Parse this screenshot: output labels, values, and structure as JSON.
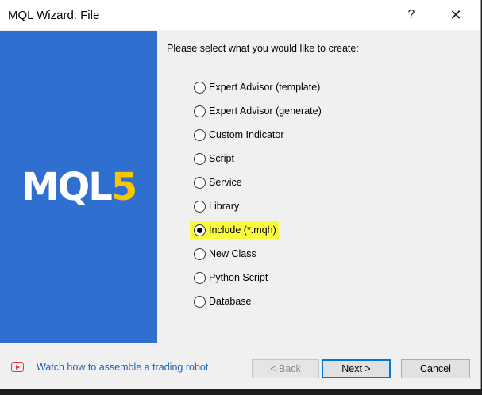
{
  "window": {
    "title": "MQL Wizard: File",
    "help_label": "?",
    "close_label": "✕"
  },
  "banner": {
    "logo_main": "MQL",
    "logo_accent": "5",
    "brand_color": "#2f6fd0",
    "accent_color": "#f6c700"
  },
  "content": {
    "prompt": "Please select what you would like to create:",
    "options": [
      {
        "label": "Expert Advisor (template)",
        "checked": false
      },
      {
        "label": "Expert Advisor (generate)",
        "checked": false
      },
      {
        "label": "Custom Indicator",
        "checked": false
      },
      {
        "label": "Script",
        "checked": false
      },
      {
        "label": "Service",
        "checked": false
      },
      {
        "label": "Library",
        "checked": false
      },
      {
        "label": "Include (*.mqh)",
        "checked": true
      },
      {
        "label": "New Class",
        "checked": false
      },
      {
        "label": "Python Script",
        "checked": false
      },
      {
        "label": "Database",
        "checked": false
      }
    ],
    "highlight_color": "#fbfb3e"
  },
  "footer": {
    "video_link": "Watch how to assemble a trading robot",
    "back_label": "< Back",
    "next_label": "Next >",
    "cancel_label": "Cancel",
    "icon": "youtube-play-icon"
  }
}
